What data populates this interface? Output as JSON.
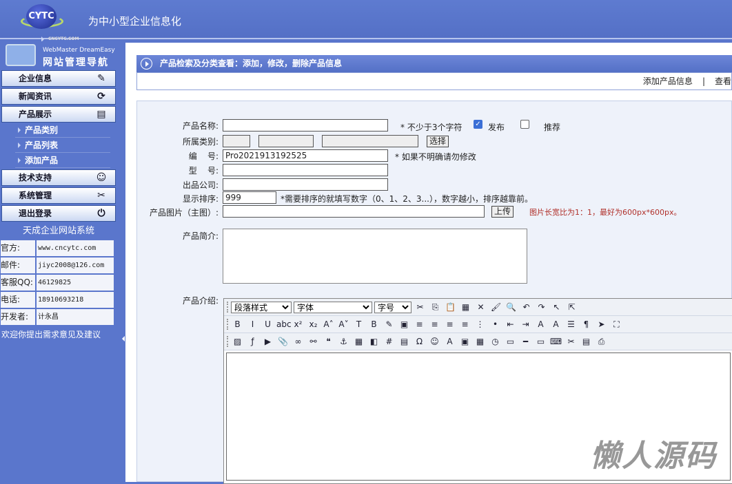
{
  "header": {
    "logo_text": "CYTC",
    "logo_sub": "CNCYTC.COM",
    "slogan": "为中小型企业信息化"
  },
  "sidebar": {
    "nav_en": "WebMaster DreamEasy",
    "nav_cn": "网站管理导航",
    "menus": [
      {
        "label": "企业信息",
        "icon": "edit-icon",
        "glyph": "✎"
      },
      {
        "label": "新闻资讯",
        "icon": "refresh-icon",
        "glyph": "⟳"
      },
      {
        "label": "产品展示",
        "icon": "document-icon",
        "glyph": "▤"
      }
    ],
    "subitems": [
      "产品类别",
      "产品列表",
      "添加产品"
    ],
    "menus2": [
      {
        "label": "技术支持",
        "icon": "support-person-icon",
        "glyph": "☺"
      },
      {
        "label": "系统管理",
        "icon": "tools-icon",
        "glyph": "✂"
      },
      {
        "label": "退出登录",
        "icon": "logout-icon",
        "glyph": "⏻"
      }
    ],
    "system_name": "天成企业网站系统",
    "info": [
      {
        "k": "官方:",
        "v": "www.cncytc.com"
      },
      {
        "k": "邮件:",
        "v": "jiyc2008@126.com"
      },
      {
        "k": "客服QQ:",
        "v": "46129825"
      },
      {
        "k": "电话:",
        "v": "18910693218"
      },
      {
        "k": "开发者:",
        "v": "计永昌"
      }
    ],
    "welcome": "欢迎你提出需求意见及建议"
  },
  "main": {
    "title": "产品检索及分类查看：添加，修改，删除产品信息",
    "actions": [
      "添加产品信息",
      "|",
      "查看"
    ],
    "form": {
      "name_label": "产品名称:",
      "name_note": "*  不少于3个字符",
      "publish": "发布",
      "recommend": "推荐",
      "category_label": "所属类别:",
      "select_btn": "选择",
      "code_label": "编    号:",
      "code_value": "Pro2021913192525",
      "code_note": "*  如果不明确请勿修改",
      "model_label": "型    号:",
      "company_label": "出品公司:",
      "order_label": "显示排序:",
      "order_value": "999",
      "order_note": "*需要排序的就填写数字（0、1、2、3...），数字越小，排序越靠前。",
      "image_label": "产品图片（主图）:",
      "upload_btn": "上传",
      "image_note": "图片长宽比为1：1，最好为600px*600px。",
      "intro_label": "产品简介:",
      "desc_label": "产品介绍:"
    },
    "editor": {
      "selects": [
        "段落样式",
        "字体",
        "字号"
      ],
      "row1": [
        [
          "cut-icon",
          "✂"
        ],
        [
          "copy-icon",
          "⎘"
        ],
        [
          "paste-icon",
          "📋"
        ],
        [
          "paste-text-icon",
          "▦"
        ],
        [
          "delete-icon",
          "✕"
        ],
        [
          "clean-icon",
          "🖌"
        ],
        [
          "find-icon",
          "🔍"
        ],
        [
          "undo-icon",
          "↶"
        ],
        [
          "redo-icon",
          "↷"
        ],
        [
          "select-icon",
          "↖"
        ],
        [
          "pointer-icon",
          "⇱"
        ]
      ],
      "row2": [
        [
          "bold-icon",
          "B"
        ],
        [
          "italic-icon",
          "I"
        ],
        [
          "underline-icon",
          "U"
        ],
        [
          "strike-icon",
          "abc"
        ],
        [
          "superscript-icon",
          "x²"
        ],
        [
          "subscript-icon",
          "x₂"
        ],
        [
          "font-grow-icon",
          "A˄"
        ],
        [
          "font-shrink-icon",
          "A˅"
        ],
        [
          "text-color-icon",
          "T"
        ],
        [
          "bg-color-icon",
          "B"
        ],
        [
          "format-icon",
          "✎"
        ],
        [
          "border-icon",
          "▣"
        ],
        [
          "align-left-icon",
          "≡"
        ],
        [
          "align-center-icon",
          "≡"
        ],
        [
          "align-right-icon",
          "≡"
        ],
        [
          "justify-icon",
          "≡"
        ],
        [
          "ordered-list-icon",
          "⋮"
        ],
        [
          "bullet-list-icon",
          "•"
        ],
        [
          "outdent-icon",
          "⇤"
        ],
        [
          "indent-icon",
          "⇥"
        ],
        [
          "ltr-icon",
          "A"
        ],
        [
          "rtl-icon",
          "A"
        ],
        [
          "line-height-icon",
          "☰"
        ],
        [
          "para-icon",
          "¶"
        ],
        [
          "template-icon",
          "➤"
        ],
        [
          "fullscreen-icon",
          "⛶"
        ]
      ],
      "row3": [
        [
          "image-icon",
          "▨"
        ],
        [
          "flash-icon",
          "ƒ"
        ],
        [
          "media-icon",
          "▶"
        ],
        [
          "attach-icon",
          "📎"
        ],
        [
          "link-icon",
          "∞"
        ],
        [
          "unlink-icon",
          "⚯"
        ],
        [
          "quote-icon",
          "❝"
        ],
        [
          "anchor-icon",
          "⚓"
        ],
        [
          "table-icon",
          "▦"
        ],
        [
          "layer-icon",
          "◧"
        ],
        [
          "grid-icon",
          "#"
        ],
        [
          "fieldset-icon",
          "▤"
        ],
        [
          "omega-icon",
          "Ω"
        ],
        [
          "emoji-icon",
          "☺"
        ],
        [
          "art-icon",
          "A"
        ],
        [
          "image-frame-icon",
          "▣"
        ],
        [
          "date-icon",
          "▦"
        ],
        [
          "time-icon",
          "◷"
        ],
        [
          "page-icon",
          "▭"
        ],
        [
          "hr-icon",
          "━"
        ],
        [
          "marquee-icon",
          "▭"
        ],
        [
          "code-icon",
          "⌨"
        ],
        [
          "pagebreak-icon",
          "✂"
        ],
        [
          "preview-icon",
          "▤"
        ],
        [
          "print-icon",
          "⎙"
        ]
      ]
    }
  },
  "watermark": "懒人源码"
}
